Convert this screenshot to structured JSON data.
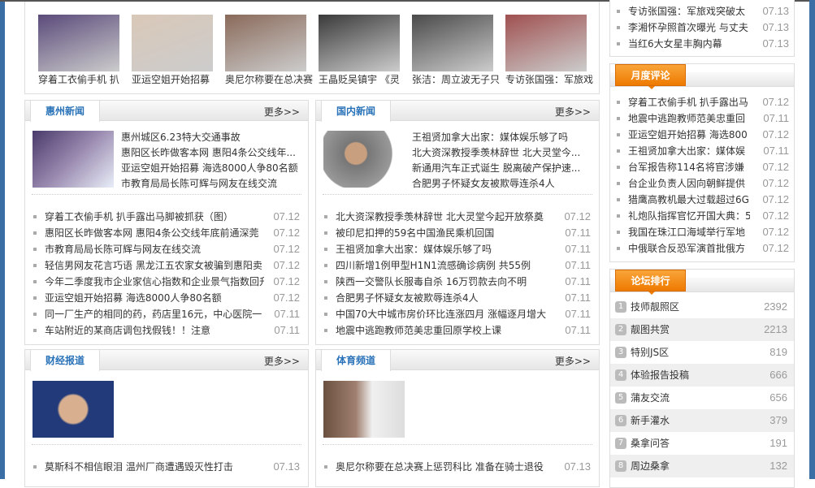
{
  "photo_strip": [
    {
      "caption": "穿着工衣偷手机 扒",
      "color": "#5a4a7a"
    },
    {
      "caption": "亚运空姐开始招募",
      "color": "#d9c8b8"
    },
    {
      "caption": "奥尼尔称要在总决赛",
      "color": "#8a6a5a"
    },
    {
      "caption": "王晶贬吴镇宇 《灵",
      "color": "#3a3a3a"
    },
    {
      "caption": "张洁：周立波无子只",
      "color": "#4a4a4a"
    },
    {
      "caption": "专访张国强：军旅戏",
      "color": "#a05050"
    }
  ],
  "huizhou": {
    "title": "惠州新闻",
    "more": "更多>>",
    "featured": [
      "惠州城区6.23特大交通事故",
      "惠阳区长昨做客本网 惠阳4条公交线年...",
      "亚运空姐开始招募 海选8000人争80名额",
      "市教育局局长陈可辉与网友在线交流"
    ],
    "items": [
      {
        "t": "穿着工衣偷手机 扒手露出马脚被抓获（图）",
        "d": "07.12"
      },
      {
        "t": "惠阳区长昨做客本网 惠阳4条公交线年底前通深莞",
        "d": "07.12"
      },
      {
        "t": "市教育局局长陈可辉与网友在线交流",
        "d": "07.12"
      },
      {
        "t": "轻信男网友花言巧语 黑龙江五农家女被骗到惠阳卖",
        "d": "07.12"
      },
      {
        "t": "今年二季度我市企业家信心指数和企业景气指数回升",
        "d": "07.12"
      },
      {
        "t": "亚运空姐开始招募 海选8000人争80名额",
        "d": "07.12"
      },
      {
        "t": "同一厂生产的相同的药，药店里16元，中心医院一",
        "d": "07.11"
      },
      {
        "t": "车站附近的某商店调包找假钱！！注意",
        "d": "07.11"
      }
    ]
  },
  "domestic": {
    "title": "国内新闻",
    "more": "更多>>",
    "featured": [
      "王祖贤加拿大出家：媒体娱乐够了吗",
      "北大资深教授季羡林辞世 北大灵堂今...",
      "新通用汽车正式诞生 脱离破产保护速...",
      "合肥男子怀疑女友被欺辱连杀4人"
    ],
    "items": [
      {
        "t": "北大资深教授季羡林辞世 北大灵堂今起开放祭奠",
        "d": "07.12"
      },
      {
        "t": "被印尼扣押的59名中国渔民乘机回国",
        "d": "07.11"
      },
      {
        "t": "王祖贤加拿大出家：媒体娱乐够了吗",
        "d": "07.11"
      },
      {
        "t": "四川新增1例甲型H1N1流感确诊病例 共55例",
        "d": "07.11"
      },
      {
        "t": "陕西一交警队长服毒自杀 16万罚款去向不明",
        "d": "07.11"
      },
      {
        "t": "合肥男子怀疑女友被欺辱连杀4人",
        "d": "07.11"
      },
      {
        "t": "中国70大中城市房价环比连涨四月 涨幅逐月增大",
        "d": "07.11"
      },
      {
        "t": "地震中逃跑教师范美忠重回原学校上课",
        "d": "07.11"
      }
    ]
  },
  "finance": {
    "title": "财经报道",
    "more": "更多>>",
    "items": [
      {
        "t": "莫斯科不相信眼泪 温州厂商遭遇毁灭性打击",
        "d": "07.13"
      }
    ]
  },
  "sports": {
    "title": "体育频道",
    "more": "更多>>",
    "items": [
      {
        "t": "奥尼尔称要在总决赛上惩罚科比 准备在骑士退役",
        "d": "07.13"
      }
    ]
  },
  "top_list": [
    {
      "t": "专访张国强：军旅戏突破太",
      "d": "07.13"
    },
    {
      "t": "李湘怀孕照首次曝光 与丈夫",
      "d": "07.13"
    },
    {
      "t": "当红6大女星丰胸内幕",
      "d": "07.13"
    }
  ],
  "monthly": {
    "title": "月度评论",
    "items": [
      {
        "t": "穿着工衣偷手机 扒手露出马",
        "d": "07.12"
      },
      {
        "t": "地震中逃跑教师范美忠重回",
        "d": "07.11"
      },
      {
        "t": "亚运空姐开始招募 海选800",
        "d": "07.12"
      },
      {
        "t": "王祖贤加拿大出家：媒体娱",
        "d": "07.11"
      },
      {
        "t": "台军报告称114名将官涉嫌",
        "d": "07.12"
      },
      {
        "t": "台企业负责人因向朝鲜提供",
        "d": "07.12"
      },
      {
        "t": "猎鹰高教机最大过载超过6G",
        "d": "07.12"
      },
      {
        "t": "礼炮队指挥官忆开国大典：5",
        "d": "07.12"
      },
      {
        "t": "我国在珠江口海域举行军地",
        "d": "07.12"
      },
      {
        "t": "中俄联合反恐军演首批俄方",
        "d": "07.12"
      }
    ]
  },
  "forum": {
    "title": "论坛排行",
    "items": [
      {
        "n": "1",
        "t": "技师靓照区",
        "c": "2392"
      },
      {
        "n": "2",
        "t": "靓图共赏",
        "c": "2213"
      },
      {
        "n": "3",
        "t": "特别JS区",
        "c": "819"
      },
      {
        "n": "4",
        "t": "体验报告投稿",
        "c": "666"
      },
      {
        "n": "5",
        "t": "蒲友交流",
        "c": "656"
      },
      {
        "n": "6",
        "t": "新手灌水",
        "c": "379"
      },
      {
        "n": "7",
        "t": "桑拿问答",
        "c": "191"
      },
      {
        "n": "8",
        "t": "周边桑拿",
        "c": "132"
      }
    ]
  }
}
